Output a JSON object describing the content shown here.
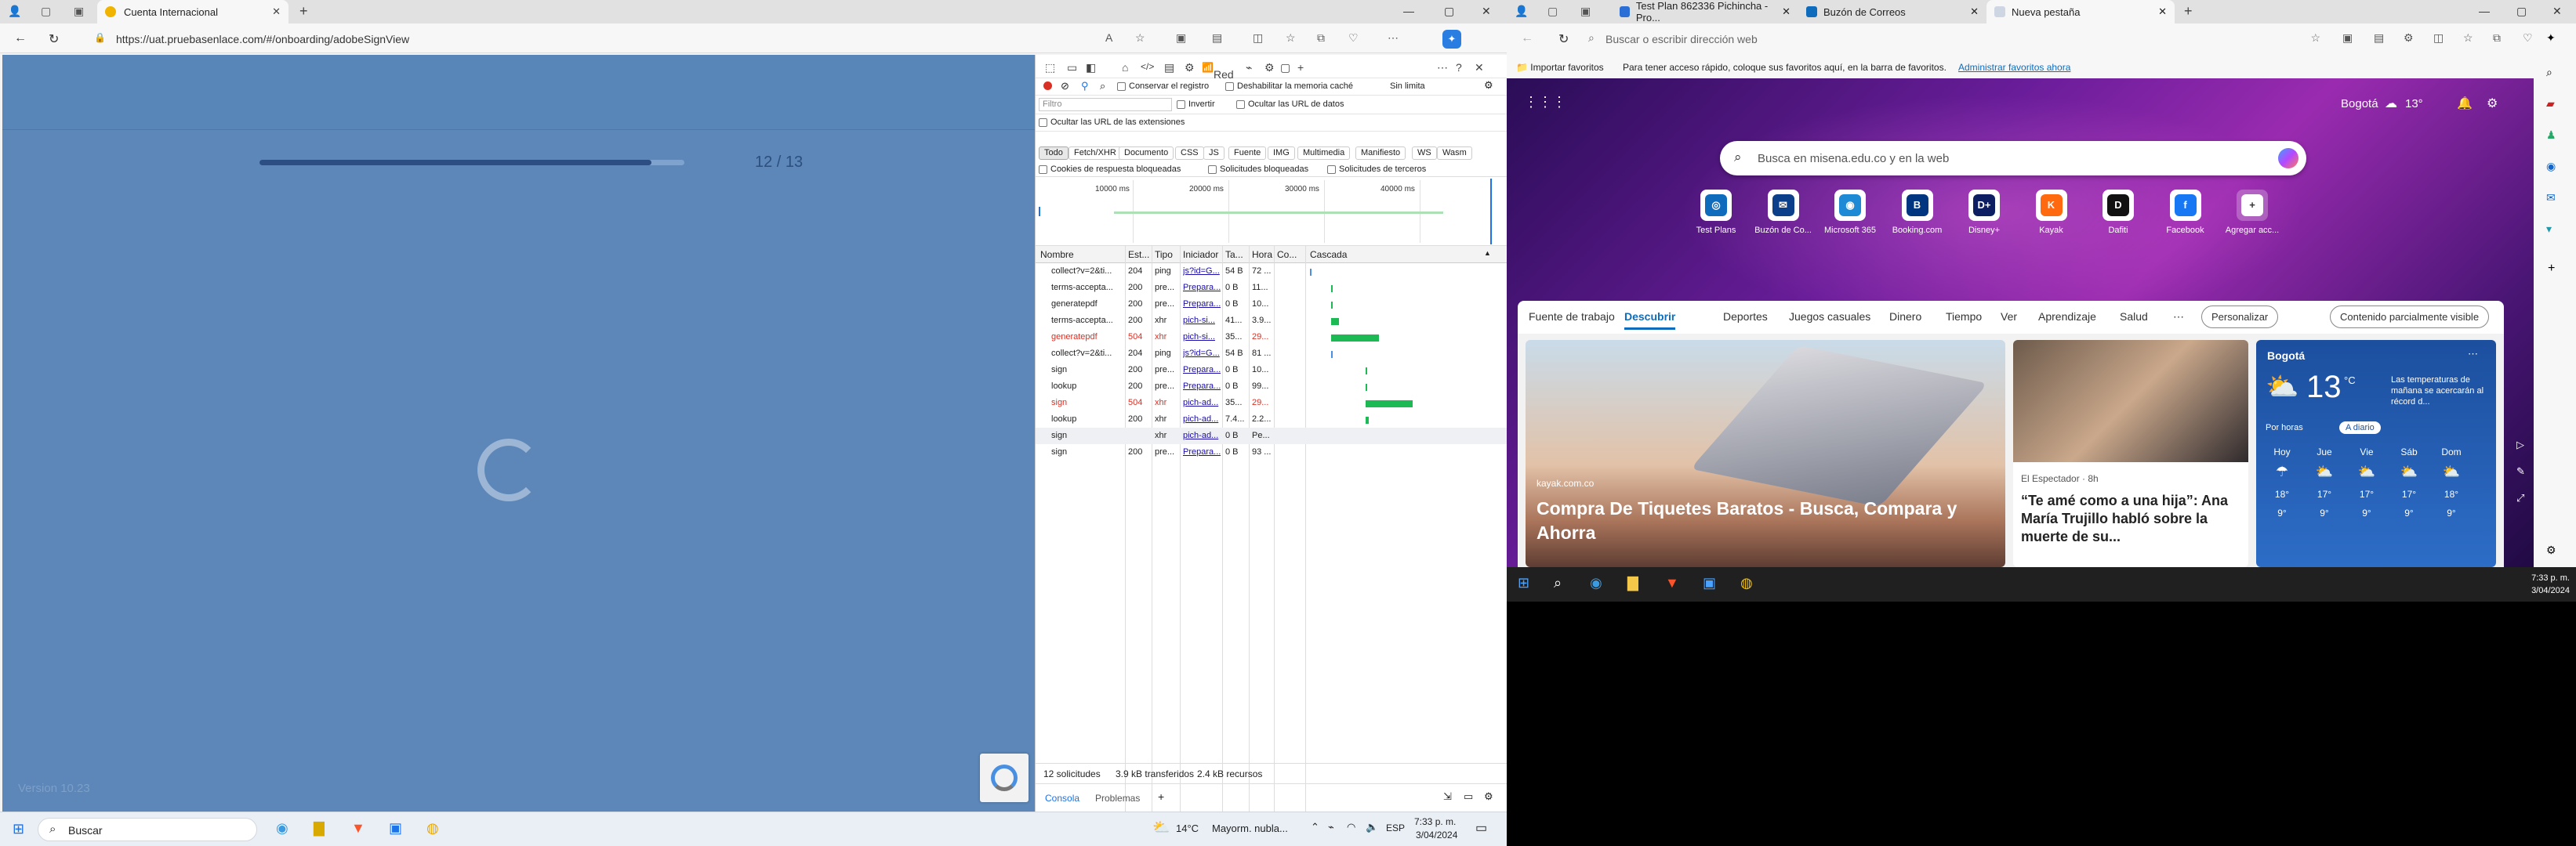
{
  "left_window": {
    "tab_title": "Cuenta Internacional",
    "url": "https://uat.pruebasenlace.com/#/onboarding/adobeSignView",
    "progress": {
      "label": "12 / 13",
      "fraction": 0.923
    },
    "version": "Version 10.23"
  },
  "devtools": {
    "active_panel": "Red",
    "toolbar": {
      "preserve_log": "Conservar el registro",
      "disable_cache": "Deshabilitar la memoria caché",
      "throttle": "Sin limita"
    },
    "filter": {
      "placeholder": "Filtro",
      "invert": "Invertir",
      "hide_data_urls": "Ocultar las URL de datos",
      "hide_extension_urls": "Ocultar las URL de las extensiones"
    },
    "type_filters": [
      "Todo",
      "Fetch/XHR",
      "Documento",
      "CSS",
      "JS",
      "Fuente",
      "IMG",
      "Multimedia",
      "Manifiesto",
      "WS",
      "Wasm"
    ],
    "blocked": {
      "cookies": "Cookies de respuesta bloqueadas",
      "requests": "Solicitudes bloqueadas",
      "third_party": "Solicitudes de terceros"
    },
    "timeline_ticks": [
      "10000 ms",
      "20000 ms",
      "30000 ms",
      "40000 ms"
    ],
    "columns": {
      "name": "Nombre",
      "status": "Est...",
      "type": "Tipo",
      "initiator": "Iniciador",
      "size": "Ta...",
      "time": "Hora",
      "comment": "Co...",
      "waterfall": "Cascada"
    },
    "rows": [
      {
        "name": "collect?v=2&ti...",
        "status": "204",
        "type": "ping",
        "initiator": "js?id=G...",
        "size": "54 B",
        "time": "72 ...",
        "error": false,
        "wf_start": 0.01,
        "wf_len": 0.005,
        "wf_color": "#4a90e2"
      },
      {
        "name": "terms-accepta...",
        "status": "200",
        "type": "pre...",
        "initiator": "Prepara...",
        "size": "0 B",
        "time": "11...",
        "error": false,
        "wf_start": 0.12,
        "wf_len": 0.008,
        "wf_color": "#1db954"
      },
      {
        "name": "generatepdf",
        "status": "200",
        "type": "pre...",
        "initiator": "Prepara...",
        "size": "0 B",
        "time": "10...",
        "error": false,
        "wf_start": 0.12,
        "wf_len": 0.008,
        "wf_color": "#1db954"
      },
      {
        "name": "terms-accepta...",
        "status": "200",
        "type": "xhr",
        "initiator": "pich-si...",
        "size": "41...",
        "time": "3.9...",
        "error": false,
        "wf_start": 0.12,
        "wf_len": 0.04,
        "wf_color": "#1db954"
      },
      {
        "name": "generatepdf",
        "status": "504",
        "type": "xhr",
        "initiator": "pich-si...",
        "size": "35...",
        "time": "29...",
        "error": true,
        "wf_start": 0.12,
        "wf_len": 0.25,
        "wf_color": "#1db954"
      },
      {
        "name": "collect?v=2&ti...",
        "status": "204",
        "type": "ping",
        "initiator": "js?id=G...",
        "size": "54 B",
        "time": "81 ...",
        "error": false,
        "wf_start": 0.12,
        "wf_len": 0.005,
        "wf_color": "#4a90e2"
      },
      {
        "name": "sign",
        "status": "200",
        "type": "pre...",
        "initiator": "Prepara...",
        "size": "0 B",
        "time": "10...",
        "error": false,
        "wf_start": 0.3,
        "wf_len": 0.008,
        "wf_color": "#1db954"
      },
      {
        "name": "lookup",
        "status": "200",
        "type": "pre...",
        "initiator": "Prepara...",
        "size": "0 B",
        "time": "99...",
        "error": false,
        "wf_start": 0.3,
        "wf_len": 0.008,
        "wf_color": "#1db954"
      },
      {
        "name": "sign",
        "status": "504",
        "type": "xhr",
        "initiator": "pich-ad...",
        "size": "35...",
        "time": "29...",
        "error": true,
        "wf_start": 0.3,
        "wf_len": 0.25,
        "wf_color": "#1db954"
      },
      {
        "name": "lookup",
        "status": "200",
        "type": "xhr",
        "initiator": "pich-ad...",
        "size": "7.4...",
        "time": "2.2...",
        "error": false,
        "wf_start": 0.3,
        "wf_len": 0.02,
        "wf_color": "#1db954"
      },
      {
        "name": "sign",
        "status": "",
        "type": "xhr",
        "initiator": "pich-ad...",
        "size": "0 B",
        "time": "Pe...",
        "error": false,
        "wf_start": 0,
        "wf_len": 0,
        "wf_color": "#1db954"
      },
      {
        "name": "sign",
        "status": "200",
        "type": "pre...",
        "initiator": "Prepara...",
        "size": "0 B",
        "time": "93 ...",
        "error": false,
        "wf_start": 0,
        "wf_len": 0,
        "wf_color": "#1db954"
      }
    ],
    "summary": {
      "requests": "12 solicitudes",
      "transferred": "3.9 kB transferidos",
      "resources": "2.4 kB recursos"
    },
    "drawer_tabs": [
      "Consola",
      "Problemas"
    ]
  },
  "right_window": {
    "tabs": [
      "Test Plan 862336 Pichincha - Pro...",
      "Buzón de Correos",
      "Nueva pestaña"
    ],
    "address_placeholder": "Buscar o escribir dirección web",
    "favorites_bar": {
      "import": "Importar favoritos",
      "hint": "Para tener acceso rápido, coloque sus favoritos aquí, en la barra de favoritos.",
      "manage_link": "Administrar favoritos ahora"
    },
    "weather_header": {
      "city": "Bogotá",
      "temp": "13°"
    },
    "search_placeholder": "Busca en misena.edu.co y en la web",
    "quick_links": [
      "Test Plans",
      "Buzón de Co...",
      "Microsoft 365",
      "Booking.com",
      "Disney+",
      "Kayak",
      "Dafiti",
      "Facebook",
      "Agregar acc..."
    ],
    "feed_tabs": [
      "Fuente de trabajo",
      "Descubrir",
      "Deportes",
      "Juegos casuales",
      "Dinero",
      "Tiempo",
      "Ver",
      "Aprendizaje",
      "Salud"
    ],
    "personalize": "Personalizar",
    "content_visibility": "Contenido parcialmente visible",
    "card1": {
      "source": "kayak.com.co",
      "title": "Compra De Tiquetes Baratos - Busca, Compara y Ahorra"
    },
    "card2": {
      "source": "El Espectador · 8h",
      "title": "“Te amé como a una hija”: Ana María Trujillo habló sobre la muerte de su..."
    },
    "weather": {
      "city": "Bogotá",
      "temp": "13",
      "unit": "°C",
      "note": "Las temperaturas de mañana se acercarán al récord d...",
      "modes": [
        "Por horas",
        "A diario"
      ],
      "days": [
        {
          "d": "Hoy",
          "hi": "18°",
          "lo": "9°"
        },
        {
          "d": "Jue",
          "hi": "17°",
          "lo": "9°"
        },
        {
          "d": "Vie",
          "hi": "17°",
          "lo": "9°"
        },
        {
          "d": "Sáb",
          "hi": "17°",
          "lo": "9°"
        },
        {
          "d": "Dom",
          "hi": "18°",
          "lo": "9°"
        }
      ]
    },
    "clock": {
      "time": "7:33 p. m.",
      "date": "3/04/2024"
    }
  },
  "taskbar": {
    "search": "Buscar",
    "weather": "14°C",
    "weather_desc": "Mayorm. nubla...",
    "lang": "ESP",
    "time": "7:33 p. m.",
    "date": "3/04/2024"
  }
}
